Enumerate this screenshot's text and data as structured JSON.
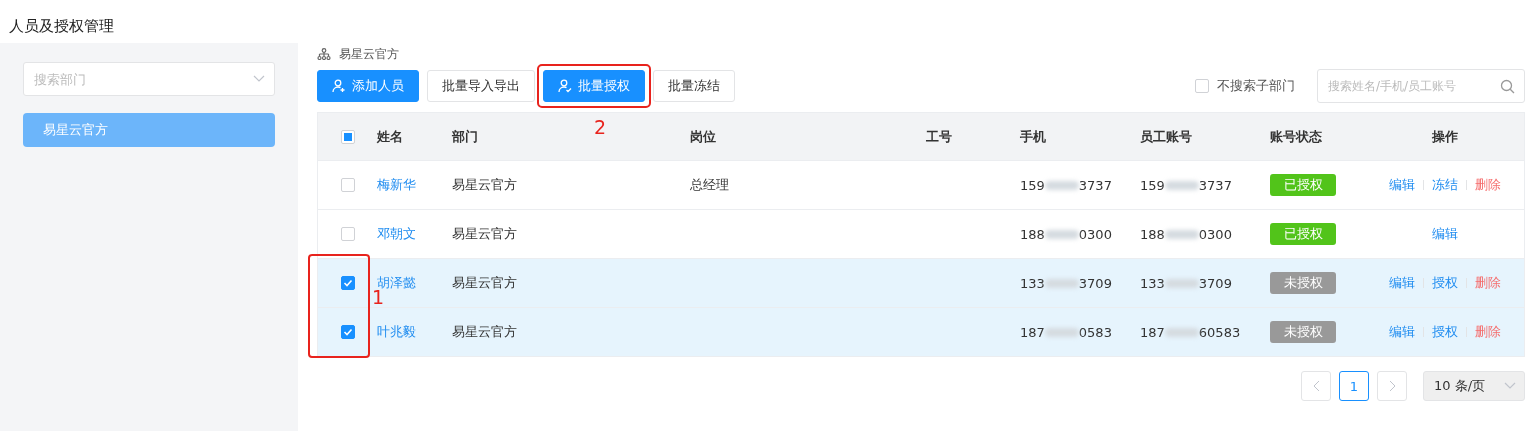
{
  "page_title": "人员及授权管理",
  "sidebar": {
    "search": {
      "placeholder": "搜索部门"
    },
    "items": [
      {
        "label": "易星云官方",
        "selected": true
      }
    ]
  },
  "breadcrumb": "易星云官方",
  "toolbar": {
    "buttons": [
      {
        "label": "添加人员",
        "kind": "add",
        "outlined": false
      },
      {
        "label": "批量导入导出",
        "kind": "default",
        "outlined": false
      },
      {
        "label": "批量授权",
        "kind": "authorize",
        "outlined": true,
        "annotation": "2"
      },
      {
        "label": "批量冻结",
        "kind": "default",
        "outlined": false
      }
    ],
    "sub_dept": {
      "label": "不搜索子部门",
      "checked": false
    },
    "search": {
      "placeholder": "搜索姓名/手机/员工账号"
    }
  },
  "table": {
    "select_all_indeterminate": true,
    "columns": [
      "姓名",
      "部门",
      "岗位",
      "工号",
      "手机",
      "员工账号",
      "账号状态",
      "操作"
    ],
    "marker_label": "1",
    "rows": [
      {
        "checked": false,
        "name": "梅新华",
        "dept": "易星云官方",
        "position": "总经理",
        "phone": {
          "start": "159",
          "end": "3737"
        },
        "account": {
          "start": "159",
          "end": "3737"
        },
        "status": {
          "label": "已授权",
          "kind": "authorized"
        },
        "actions": [
          {
            "label": "编辑",
            "kind": "link"
          },
          {
            "label": "冻结",
            "kind": "link"
          },
          {
            "label": "删除",
            "kind": "danger"
          }
        ]
      },
      {
        "checked": false,
        "name": "邓朝文",
        "dept": "易星云官方",
        "phone": {
          "start": "188",
          "end": "0300"
        },
        "account": {
          "start": "188",
          "end": "0300"
        },
        "status": {
          "label": "已授权",
          "kind": "authorized"
        },
        "actions": [
          {
            "label": "编辑",
            "kind": "link"
          }
        ]
      },
      {
        "checked": true,
        "name": "胡泽懿",
        "dept": "易星云官方",
        "phone": {
          "start": "133",
          "end": "3709"
        },
        "account": {
          "start": "133",
          "end": "3709"
        },
        "status": {
          "label": "未授权",
          "kind": "unauthorized"
        },
        "actions": [
          {
            "label": "编辑",
            "kind": "link"
          },
          {
            "label": "授权",
            "kind": "link"
          },
          {
            "label": "删除",
            "kind": "danger"
          }
        ]
      },
      {
        "checked": true,
        "name": "叶兆毅",
        "dept": "易星云官方",
        "phone": {
          "start": "187",
          "end": "0583"
        },
        "account": {
          "start": "187",
          "end": "60583"
        },
        "status": {
          "label": "未授权",
          "kind": "unauthorized"
        },
        "actions": [
          {
            "label": "编辑",
            "kind": "link"
          },
          {
            "label": "授权",
            "kind": "link"
          },
          {
            "label": "删除",
            "kind": "danger"
          }
        ]
      }
    ]
  },
  "pagination": {
    "pages": [
      {
        "label": "1",
        "selected": true
      }
    ],
    "page_size": "10 条/页"
  }
}
